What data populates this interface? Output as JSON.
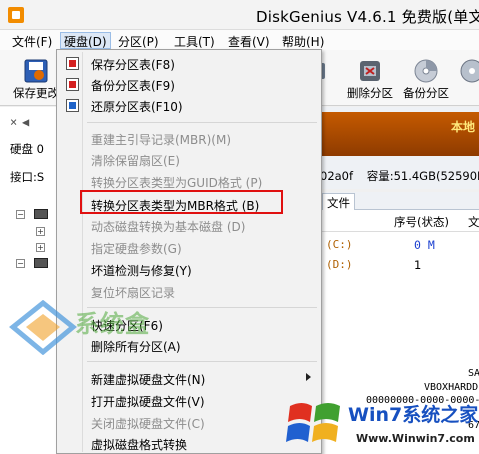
{
  "window": {
    "title": "DiskGenius V4.6.1 免费版(单文件"
  },
  "menubar": {
    "items": [
      {
        "label": "文件(F)"
      },
      {
        "label": "硬盘(D)"
      },
      {
        "label": "分区(P)"
      },
      {
        "label": "工具(T)"
      },
      {
        "label": "查看(V)"
      },
      {
        "label": "帮助(H)"
      }
    ]
  },
  "toolbar": {
    "save_label": "保存更改",
    "partial_label": "化",
    "delete_partition_label": "删除分区",
    "backup_partition_label": "备份分区"
  },
  "left_panel": {
    "disk_label": "硬盘 0",
    "interface_label": "接口:S"
  },
  "disk_info": {
    "banner_text": "本地",
    "guid_fragment": "02a0f",
    "capacity_label": "容量:51.4GB(52590MB"
  },
  "tabs": {
    "files_label": "文件"
  },
  "grid": {
    "seq_header": "序号(状态)",
    "extra_header": "文",
    "rows": [
      {
        "drive": "(C:)",
        "seq": "0 M"
      },
      {
        "drive": "(D:)",
        "seq": "1"
      }
    ]
  },
  "disk_menu": {
    "items": [
      {
        "label": "保存分区表(F8)",
        "enabled": true,
        "icon": "save-icon"
      },
      {
        "label": "备份分区表(F9)",
        "enabled": true,
        "icon": "backup-icon"
      },
      {
        "label": "还原分区表(F10)",
        "enabled": true,
        "icon": "restore-icon"
      },
      {
        "label": "重建主引导记录(MBR)(M)",
        "enabled": false
      },
      {
        "label": "清除保留扇区(E)",
        "enabled": false
      },
      {
        "label": "转换分区表类型为GUID格式 (P)",
        "enabled": false
      },
      {
        "label": "转换分区表类型为MBR格式 (B)",
        "enabled": true
      },
      {
        "label": "动态磁盘转换为基本磁盘 (D)",
        "enabled": false
      },
      {
        "label": "指定硬盘参数(G)",
        "enabled": false
      },
      {
        "label": "坏道检测与修复(Y)",
        "enabled": true
      },
      {
        "label": "复位坏扇区记录",
        "enabled": false
      },
      {
        "label": "快速分区(F6)",
        "enabled": true
      },
      {
        "label": "删除所有分区(A)",
        "enabled": true
      },
      {
        "label": "新建虚拟硬盘文件(N)",
        "enabled": true,
        "submenu": true
      },
      {
        "label": "打开虚拟硬盘文件(V)",
        "enabled": true
      },
      {
        "label": "关闭虚拟硬盘文件(C)",
        "enabled": false
      },
      {
        "label": "虚拟磁盘格式转换",
        "enabled": true
      }
    ]
  },
  "right_panel": {
    "line1": "SA",
    "line2": "VBOXHARDDI",
    "line3": "00000000-0000-0000-",
    "line4": "67"
  },
  "watermarks": {
    "site_a": "系统盒",
    "win7_brand": "Win7系统之家",
    "win7_url": "Www.Winwin7.com"
  },
  "colors": {
    "highlight_border": "#e01010",
    "disabled_text": "#8d8d8d",
    "banner_bg": "#c55a00"
  }
}
